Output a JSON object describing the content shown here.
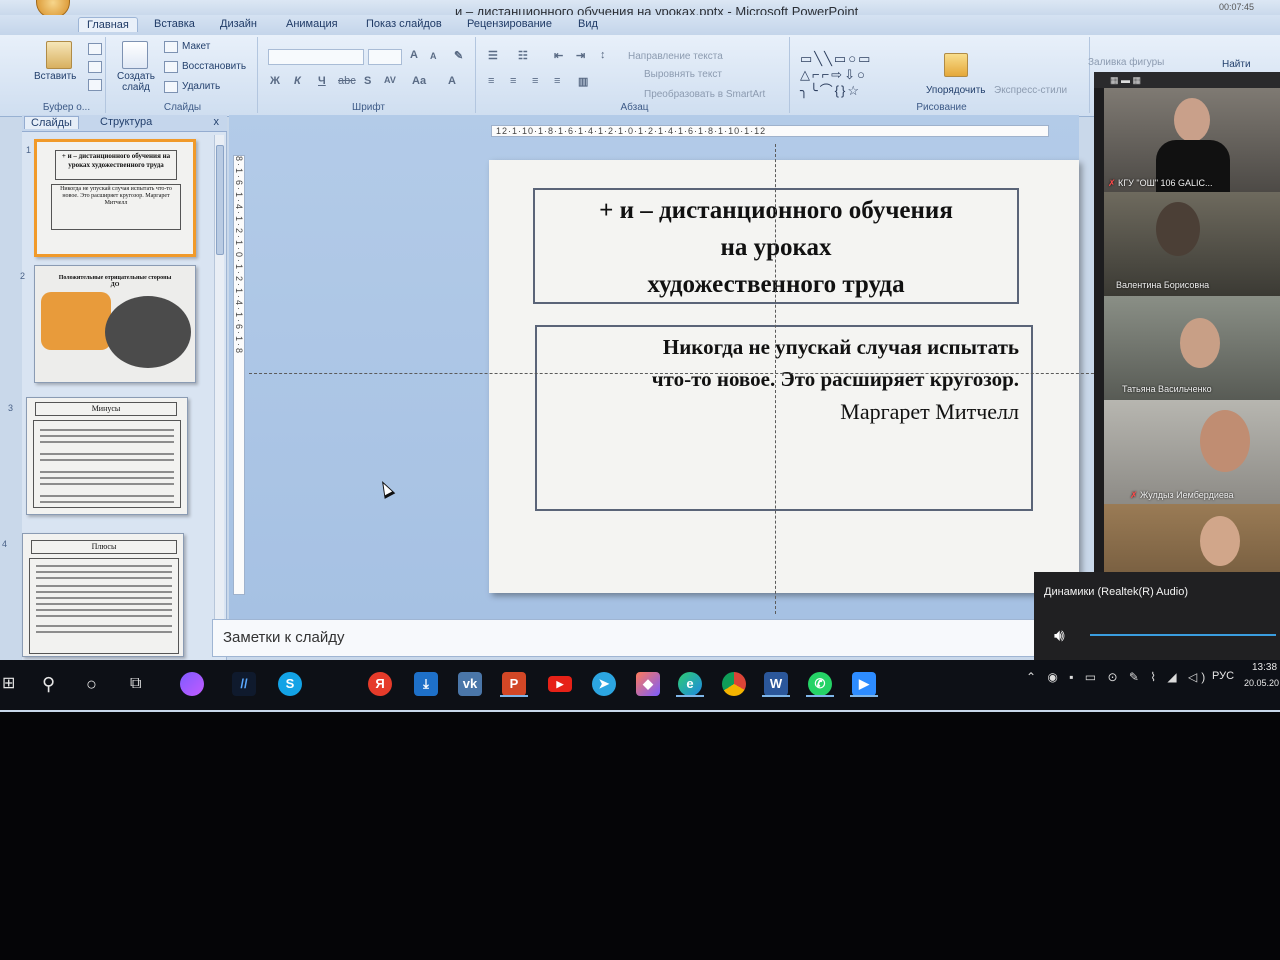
{
  "window": {
    "title": "и – дистанционного обучения на уроках.pptx - Microsoft PowerPoint",
    "corner_clock": "00:07:45"
  },
  "ribbon": {
    "tabs": [
      "Главная",
      "Вставка",
      "Дизайн",
      "Анимация",
      "Показ слайдов",
      "Рецензирование",
      "Вид"
    ],
    "active_tab": "Главная",
    "clipboard": {
      "paste": "Вставить",
      "group_label": "Буфер о..."
    },
    "slides_group": {
      "new_slide": "Создать слайд",
      "layout": "Макет",
      "reset": "Восстановить",
      "delete": "Удалить",
      "group_label": "Слайды"
    },
    "font_group": {
      "group_label": "Шрифт",
      "bold": "Ж",
      "italic": "К",
      "underline": "Ч",
      "strike": "abc",
      "shadow": "S",
      "spacing": "AV",
      "case": "Aa",
      "color": "A"
    },
    "paragraph_group": {
      "group_label": "Абзац",
      "text_direction": "Направление текста",
      "align_text": "Выровнять текст",
      "smartart": "Преобразовать в SmartArt"
    },
    "drawing_group": {
      "group_label": "Рисование",
      "arrange": "Упорядочить",
      "quick_styles": "Экспресс-стили",
      "shape_fill": "Заливка фигуры"
    },
    "editing_group": {
      "find": "Найти"
    }
  },
  "slides_panel": {
    "tabs": [
      "Слайды",
      "Структура"
    ],
    "close": "x",
    "thumbnails": [
      {
        "number": "1",
        "title": "+ и – дистанционного обучения на уроках художественного труда",
        "body": "Никогда не упускай случая испытать что-то новое. Это расширяет кругозор. Маргарет Митчелл",
        "selected": true
      },
      {
        "number": "2",
        "title": "Положительные отрицательные стороны ДО"
      },
      {
        "number": "3",
        "title": "Минусы"
      },
      {
        "number": "4",
        "title": "Плюсы"
      }
    ]
  },
  "rulers": {
    "horizontal": "12·1·10·1·8·1·6·1·4·1·2·1·0·1·2·1·4·1·6·1·8·1·10·1·12",
    "vertical": "8·1·6·1·4·1·2·1·0·1·2·1·4·1·6·1·8"
  },
  "slide": {
    "title_line1": "+ и – дистанционного обучения",
    "title_line2": "на уроках",
    "title_line3": "художественного труда",
    "quote_line1": "Никогда не упускай случая испытать",
    "quote_line2": "что-то новое. Это расширяет кругозор.",
    "author": "Маргарет  Митчелл"
  },
  "notes": {
    "placeholder": "Заметки к слайду"
  },
  "video_call": {
    "participants": [
      {
        "name": "КГУ \"ОШ\" 106 GALIC...",
        "muted": true
      },
      {
        "name": "Валентина Борисовна",
        "muted": false
      },
      {
        "name": "Татьяна Васильченко",
        "muted": false
      },
      {
        "name": "Жулдыз Иембердиева",
        "muted": true
      },
      {
        "name": "",
        "muted": false
      }
    ]
  },
  "audio_popup": {
    "device": "Динамики (Realtek(R) Audio)",
    "volume": 1.0
  },
  "taskbar": {
    "apps": [
      "Поиск",
      "Cortana",
      "Представление задач",
      "Алиса",
      "Мой стол",
      "Skype",
      "Яндекс",
      "Поиск файлов",
      "ВКонтакте",
      "PowerPoint",
      "YouTube",
      "Telegram",
      "Zoom Apps",
      "Edge",
      "Chrome",
      "Word",
      "WhatsApp",
      "Zoom"
    ],
    "language": "РУС",
    "time": "13:38",
    "date": "20.05.20"
  },
  "colors": {
    "ribbon_bg": "#dce7f4",
    "selected_thumb": "#f19a2a",
    "taskbar_bg": "#0d1016",
    "volume_accent": "#3a9ddf"
  }
}
